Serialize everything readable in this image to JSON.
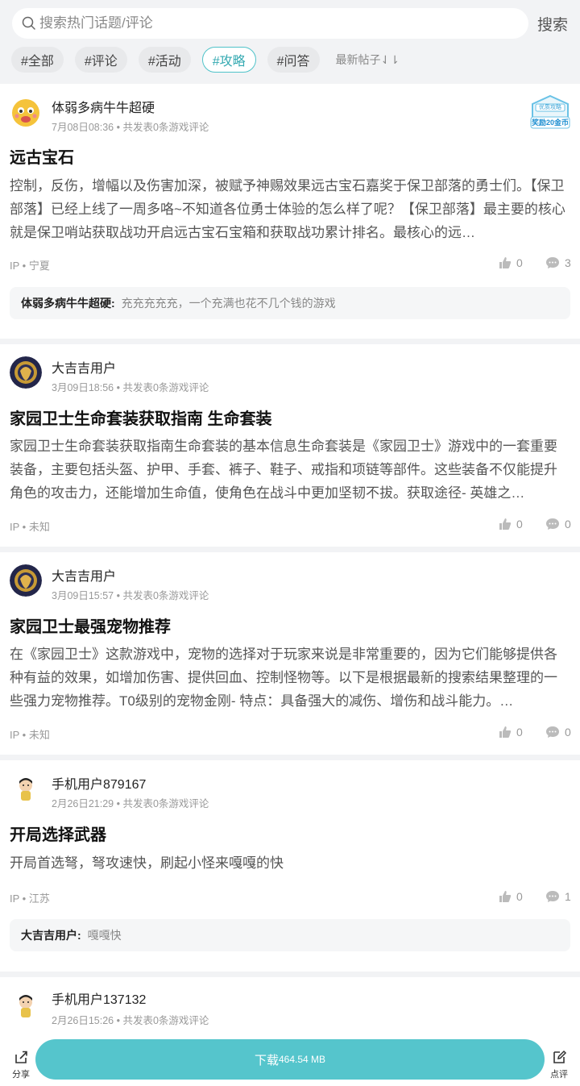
{
  "search": {
    "placeholder": "搜索热门话题/评论",
    "button": "搜索"
  },
  "tags": [
    "#全部",
    "#评论",
    "#活动",
    "#攻略",
    "#问答"
  ],
  "active_tag": "#攻略",
  "sort_label": "最新帖子⇃⇂",
  "posts": [
    {
      "user": "体弱多病牛牛超硬",
      "meta": "7月08日08:36 • 共发表0条游戏评论",
      "title": "远古宝石",
      "body": "控制，反伤，增幅以及伤害加深，被赋予神赐效果远古宝石嘉奖于保卫部落的勇士们。【保卫部落】已经上线了一周多咯~不知道各位勇士体验的怎么样了呢？【保卫部落】最主要的核心就是保卫哨站获取战功开启远古宝石宝箱和获取战功累计排名。最核心的远…",
      "ip": "IP • 宁夏",
      "likes": "0",
      "comments": "3",
      "reply_user": "体弱多病牛牛超硬:",
      "reply_text": "充充充充充，一个充满也花不几个钱的游戏",
      "badge_top": "优质攻略",
      "badge_bottom": "奖励20金币"
    },
    {
      "user": "大吉吉用户",
      "meta": "3月09日18:56 • 共发表0条游戏评论",
      "title": "家园卫士生命套装获取指南 生命套装",
      "body": "家园卫士生命套装获取指南生命套装的基本信息生命套装是《家园卫士》游戏中的一套重要装备，主要包括头盔、护甲、手套、裤子、鞋子、戒指和项链等部件。这些装备不仅能提升角色的攻击力，还能增加生命值，使角色在战斗中更加坚韧不拔。获取途径- 英雄之…",
      "ip": "IP • 未知",
      "likes": "0",
      "comments": "0"
    },
    {
      "user": "大吉吉用户",
      "meta": "3月09日15:57 • 共发表0条游戏评论",
      "title": "家园卫士最强宠物推荐",
      "body": "在《家园卫士》这款游戏中，宠物的选择对于玩家来说是非常重要的，因为它们能够提供各种有益的效果，如增加伤害、提供回血、控制怪物等。以下是根据最新的搜索结果整理的一些强力宠物推荐。T0级别的宠物金刚- 特点：具备强大的减伤、增伤和战斗能力。…",
      "ip": "IP • 未知",
      "likes": "0",
      "comments": "0"
    },
    {
      "user": "手机用户879167",
      "meta": "2月26日21:29 • 共发表0条游戏评论",
      "title": "开局选择武器",
      "body": "开局首选弩，弩攻速快，刷起小怪来嘎嘎的快",
      "ip": "IP • 江苏",
      "likes": "0",
      "comments": "1",
      "reply_user": "大吉吉用户:",
      "reply_text": "嘎嘎快"
    },
    {
      "user": "手机用户137132",
      "meta": "2月26日15:26 • 共发表0条游戏评论"
    }
  ],
  "bottom": {
    "share": "分享",
    "download": "下载",
    "download_size": "464.54 MB",
    "review": "点评"
  }
}
